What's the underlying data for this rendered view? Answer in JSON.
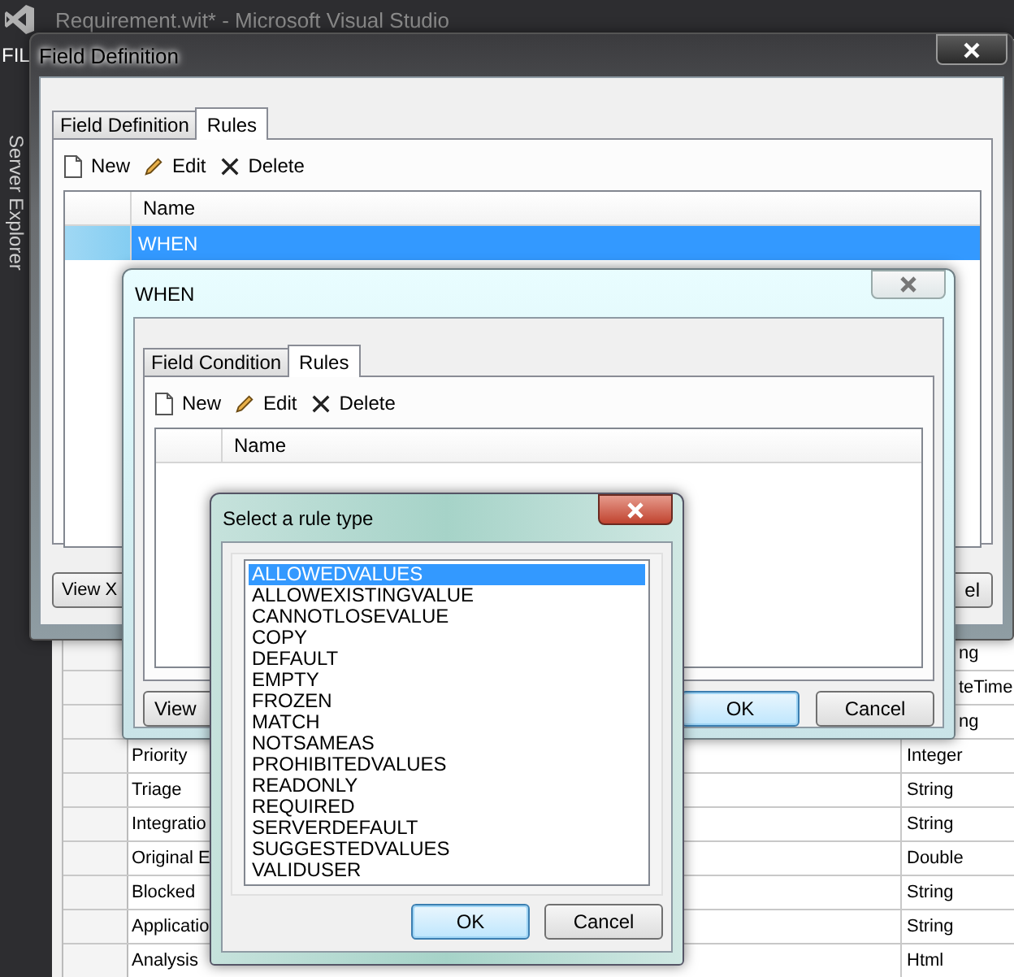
{
  "vs_window": {
    "title": "Requirement.wit* - Microsoft Visual Studio",
    "menu_fragment": "FIL",
    "side_tab": "Server Explorer"
  },
  "background_grid": {
    "rows": [
      {
        "type": "ng"
      },
      {
        "type": "teTime"
      },
      {
        "type": "ng"
      },
      {
        "name": "Priority",
        "type": "Integer"
      },
      {
        "name": "Triage",
        "type": "String"
      },
      {
        "name": "Integratio",
        "type": "String"
      },
      {
        "name": "Original E",
        "type": "Double"
      },
      {
        "name": "Blocked",
        "type": "String"
      },
      {
        "name": "Applicatio",
        "type": "String"
      },
      {
        "name": "Analysis",
        "type": "Html"
      }
    ]
  },
  "field_definition_dialog": {
    "title": "Field Definition",
    "tabs": [
      {
        "label": "Field Definition",
        "selected": false
      },
      {
        "label": "Rules",
        "selected": true
      }
    ],
    "toolbar": [
      {
        "kind": "new",
        "label": "New"
      },
      {
        "kind": "edit",
        "label": "Edit"
      },
      {
        "kind": "delete",
        "label": "Delete"
      }
    ],
    "columns": [
      "Name"
    ],
    "rows": [
      {
        "name": "WHEN",
        "selected": true
      }
    ],
    "buttons": [
      {
        "label": "View X"
      },
      {
        "label": "el"
      }
    ]
  },
  "when_dialog": {
    "title": "WHEN",
    "tabs": [
      {
        "label": "Field Condition",
        "selected": false
      },
      {
        "label": "Rules",
        "selected": true
      }
    ],
    "toolbar": [
      {
        "kind": "new",
        "label": "New"
      },
      {
        "kind": "edit",
        "label": "Edit"
      },
      {
        "kind": "delete",
        "label": "Delete"
      }
    ],
    "columns": [
      "Name"
    ],
    "buttons": [
      {
        "label": "View",
        "focused": false
      },
      {
        "label": "OK",
        "focused": true
      },
      {
        "label": "Cancel",
        "focused": false
      }
    ]
  },
  "rule_type_dialog": {
    "title": "Select a rule type",
    "items": [
      {
        "label": "ALLOWEDVALUES",
        "selected": true
      },
      {
        "label": "ALLOWEXISTINGVALUE",
        "selected": false
      },
      {
        "label": "CANNOTLOSEVALUE",
        "selected": false
      },
      {
        "label": "COPY",
        "selected": false
      },
      {
        "label": "DEFAULT",
        "selected": false
      },
      {
        "label": "EMPTY",
        "selected": false
      },
      {
        "label": "FROZEN",
        "selected": false
      },
      {
        "label": "MATCH",
        "selected": false
      },
      {
        "label": "NOTSAMEAS",
        "selected": false
      },
      {
        "label": "PROHIBITEDVALUES",
        "selected": false
      },
      {
        "label": "READONLY",
        "selected": false
      },
      {
        "label": "REQUIRED",
        "selected": false
      },
      {
        "label": "SERVERDEFAULT",
        "selected": false
      },
      {
        "label": "SUGGESTEDVALUES",
        "selected": false
      },
      {
        "label": "VALIDUSER",
        "selected": false
      }
    ],
    "buttons": [
      {
        "label": "OK",
        "focused": true
      },
      {
        "label": "Cancel",
        "focused": false
      }
    ]
  }
}
